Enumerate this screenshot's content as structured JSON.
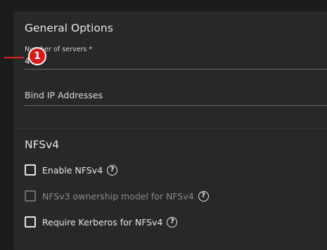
{
  "general": {
    "title": "General Options",
    "servers_label": "Number of servers *",
    "servers_value": "4",
    "bind_ip_label": "Bind IP Addresses"
  },
  "annotation": {
    "marker": "1"
  },
  "nfsv4": {
    "title": "NFSv4",
    "options": [
      {
        "label": "Enable NFSv4",
        "checked": false,
        "disabled": false
      },
      {
        "label": "NFSv3 ownership model for NFSv4",
        "checked": false,
        "disabled": true
      },
      {
        "label": "Require Kerberos for NFSv4",
        "checked": false,
        "disabled": false
      }
    ],
    "help_glyph": "?"
  },
  "colors": {
    "accent": "#e02020",
    "card": "#282828",
    "background": "#1c1c1c"
  }
}
